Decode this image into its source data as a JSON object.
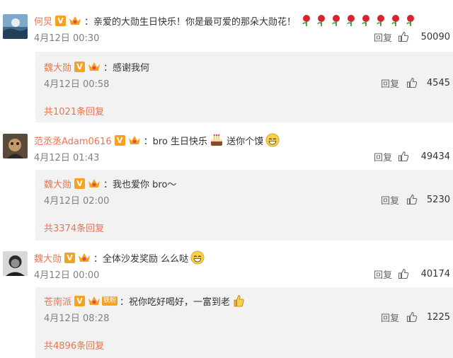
{
  "comments": [
    {
      "user": "何炅",
      "text": "亲爱的大勋生日快乐！你是最可爱的那朵大勋花！",
      "time": "4月12日 00:30",
      "reply_label": "回复",
      "likes": "50090",
      "emoji": "rose",
      "emoji_count": 8,
      "reply": {
        "user": "魏大勋",
        "text": "感谢我何",
        "time": "4月12日 00:58",
        "reply_label": "回复",
        "likes": "4545"
      },
      "total": "共1021条回复"
    },
    {
      "user": "范丞丞Adam0616",
      "text_a": "bro 生日快乐",
      "text_b": "送你个馍",
      "time": "4月12日 01:43",
      "reply_label": "回复",
      "likes": "49434",
      "reply": {
        "user": "魏大勋",
        "text": "我也爱你 bro～",
        "time": "4月12日 02:00",
        "reply_label": "回复",
        "likes": "5230"
      },
      "total": "共3374条回复"
    },
    {
      "user": "魏大勋",
      "text": "全体沙发奖励 么么哒",
      "time": "4月12日 00:00",
      "reply_label": "回复",
      "likes": "40174",
      "reply": {
        "user": "苍南派",
        "fan_badge": "铁粉",
        "text": "祝你吃好喝好，一富到老",
        "time": "4月12日 08:28",
        "reply_label": "回复",
        "likes": "1225"
      },
      "total": "共4896条回复"
    }
  ],
  "colors": {
    "accent": "#eb7350",
    "badge": "#f7a123",
    "reply_bg": "#f2f2f2",
    "meta": "#808080"
  },
  "icons": {
    "verified": "V",
    "like": "thumbs-up-icon",
    "member": "crown-icon"
  }
}
